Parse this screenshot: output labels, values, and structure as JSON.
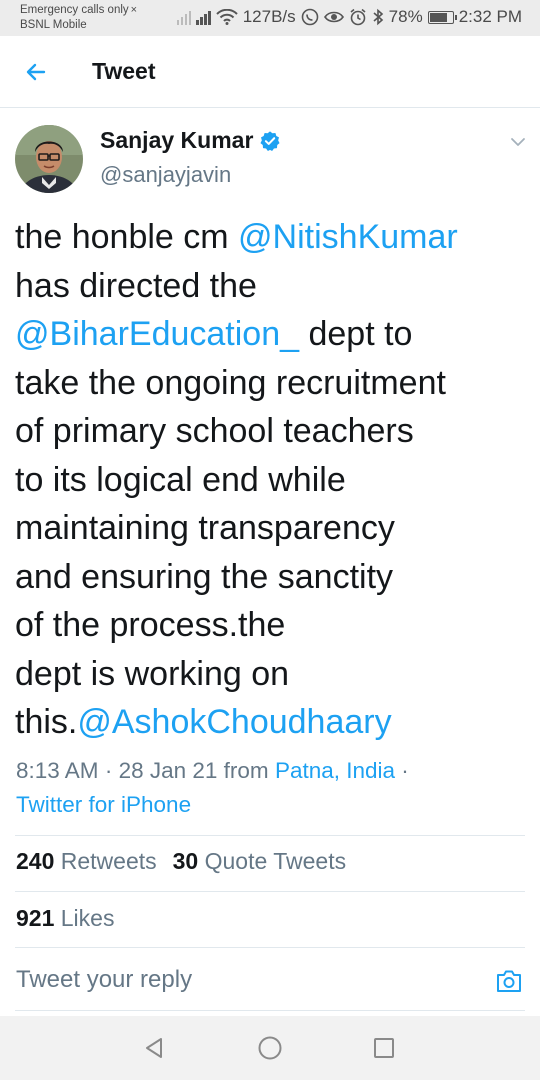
{
  "status_bar": {
    "carrier_line1": "Emergency calls only",
    "carrier_line2": "BSNL Mobile",
    "speed": "127B/s",
    "battery": "78%",
    "time": "2:32 PM",
    "icons": [
      "signal-icon",
      "wifi-icon",
      "whatsapp-icon",
      "eye-icon",
      "alarm-icon",
      "bluetooth-icon",
      "battery-icon"
    ]
  },
  "header": {
    "title": "Tweet",
    "back_icon": "arrow-left-icon"
  },
  "author": {
    "name": "Sanjay Kumar",
    "handle": "@sanjayjavin",
    "verified": true
  },
  "tweet": {
    "segments": [
      {
        "text": "the honble cm ",
        "type": "text"
      },
      {
        "text": "@NitishKumar",
        "type": "mention"
      },
      {
        "text": "\nhas directed the\n",
        "type": "text"
      },
      {
        "text": "@BiharEducation_",
        "type": "mention"
      },
      {
        "text": "  dept to\ntake the ongoing recruitment\nof primary school teachers\nto its logical end while\nmaintaining  transparency\nand ensuring the sanctity\nof the process.the\ndept is working on\nthis.",
        "type": "text"
      },
      {
        "text": "@AshokChoudhaary",
        "type": "mention"
      }
    ],
    "time": "8:13 AM",
    "date": "28 Jan 21",
    "from_label": "from",
    "location": "Patna, India",
    "source": "Twitter for iPhone"
  },
  "stats": {
    "retweets_count": "240",
    "retweets_label": "Retweets",
    "quotes_count": "30",
    "quotes_label": "Quote Tweets",
    "likes_count": "921",
    "likes_label": "Likes"
  },
  "reply": {
    "placeholder": "Tweet your reply"
  },
  "colors": {
    "accent": "#1da1f2",
    "muted": "#657786",
    "text": "#14171a",
    "divider": "#e1e8ed"
  }
}
